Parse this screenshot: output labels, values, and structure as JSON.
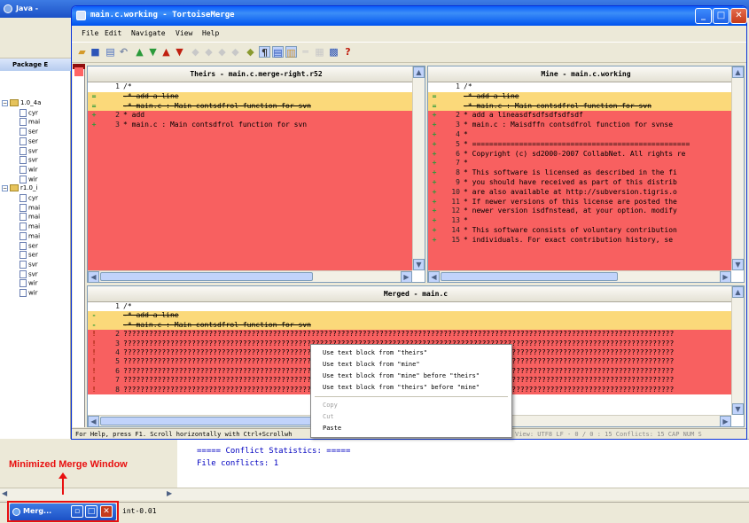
{
  "eclipse": {
    "title": "Java - ",
    "panel_tab": "Package E",
    "tree": [
      {
        "label": "1.0_4a",
        "kind": "folder"
      },
      {
        "label": "cyr",
        "kind": "file"
      },
      {
        "label": "mai",
        "kind": "file"
      },
      {
        "label": "ser",
        "kind": "file"
      },
      {
        "label": "ser",
        "kind": "file"
      },
      {
        "label": "svr",
        "kind": "file"
      },
      {
        "label": "svr",
        "kind": "file"
      },
      {
        "label": "wir",
        "kind": "file"
      },
      {
        "label": "wir",
        "kind": "file"
      },
      {
        "label": "r1.0_i",
        "kind": "folder"
      },
      {
        "label": "cyr",
        "kind": "file"
      },
      {
        "label": "mai",
        "kind": "file"
      },
      {
        "label": "mai",
        "kind": "file"
      },
      {
        "label": "mai",
        "kind": "file"
      },
      {
        "label": "mai",
        "kind": "file"
      },
      {
        "label": "ser",
        "kind": "file"
      },
      {
        "label": "ser",
        "kind": "file"
      },
      {
        "label": "svr",
        "kind": "file"
      },
      {
        "label": "svr",
        "kind": "file"
      },
      {
        "label": "wir",
        "kind": "file"
      },
      {
        "label": "wir",
        "kind": "file"
      }
    ],
    "console_lines": [
      "===== Conflict Statistics: =====",
      "File conflicts: 1"
    ],
    "status_right": "int-0.01"
  },
  "annotation": {
    "text": "Minimized Merge Window"
  },
  "minimized": {
    "title": "Merg..."
  },
  "window": {
    "title": "main.c.working - TortoiseMerge",
    "menu": [
      "File",
      "Edit",
      "Navigate",
      "View",
      "Help"
    ],
    "status": "For Help, press F1. Scroll horizontally with Ctrl+Scrollwh",
    "status_right": "View: UTF8 LF   - 0 / 0 : 15  Conflicts: 15  CAP NUM S"
  },
  "theirs": {
    "header": "Theirs - main.c.merge-right.r52",
    "rows": [
      {
        "gutter": "",
        "num": "1",
        "text": "/*",
        "bg": "white",
        "strike": false
      },
      {
        "gutter": "=",
        "num": "",
        "text": "-* add a line",
        "bg": "orange",
        "strike": true
      },
      {
        "gutter": "=",
        "num": "",
        "text": "-* main.c :  Main contsdfrol function for svn",
        "bg": "orange",
        "strike": true
      },
      {
        "gutter": "+",
        "num": "2",
        "text": " * add",
        "bg": "red",
        "strike": false
      },
      {
        "gutter": "+",
        "num": "3",
        "text": " * main.c :  Main contsdfrol function for svn",
        "bg": "red",
        "strike": false
      }
    ]
  },
  "mine": {
    "header": "Mine - main.c.working",
    "rows": [
      {
        "gutter": "",
        "num": "1",
        "text": "/*",
        "bg": "white",
        "strike": false
      },
      {
        "gutter": "=",
        "num": "",
        "text": "-* add a line",
        "bg": "orange",
        "strike": true
      },
      {
        "gutter": "=",
        "num": "",
        "text": "-* main.c :  Main contsdfrol function for svn",
        "bg": "orange",
        "strike": true
      },
      {
        "gutter": "+",
        "num": "2",
        "text": " * add a lineasdfsdfsdfsdfsdf",
        "bg": "red",
        "strike": false
      },
      {
        "gutter": "+",
        "num": "3",
        "text": " * main.c :  Maisdffn contsdfrol function for svnse",
        "bg": "red",
        "strike": false
      },
      {
        "gutter": "+",
        "num": "4",
        "text": " *",
        "bg": "red",
        "strike": false
      },
      {
        "gutter": "+",
        "num": "5",
        "text": " * ===================================================",
        "bg": "red",
        "strike": false
      },
      {
        "gutter": "+",
        "num": "6",
        "text": " * Copyright (c) sd2000-2007 CollabNet.  All rights re",
        "bg": "red",
        "strike": false
      },
      {
        "gutter": "+",
        "num": "7",
        "text": " *",
        "bg": "red",
        "strike": false
      },
      {
        "gutter": "+",
        "num": "8",
        "text": " * This software is licensed as described in the fi",
        "bg": "red",
        "strike": false
      },
      {
        "gutter": "+",
        "num": "9",
        "text": " * you should have received as part of this distrib",
        "bg": "red",
        "strike": false
      },
      {
        "gutter": "+",
        "num": "10",
        "text": " * are also available at http://subversion.tigris.o",
        "bg": "red",
        "strike": false
      },
      {
        "gutter": "+",
        "num": "11",
        "text": " * If newer versions of this license are posted the",
        "bg": "red",
        "strike": false
      },
      {
        "gutter": "+",
        "num": "12",
        "text": " * newer version isdfnstead, at your option. modify",
        "bg": "red",
        "strike": false
      },
      {
        "gutter": "+",
        "num": "13",
        "text": " *",
        "bg": "red",
        "strike": false
      },
      {
        "gutter": "+",
        "num": "14",
        "text": " * This software consists of voluntary contribution",
        "bg": "red",
        "strike": false
      },
      {
        "gutter": "+",
        "num": "15",
        "text": " * individuals.  For exact contribution history, se",
        "bg": "red",
        "strike": false
      }
    ]
  },
  "merged": {
    "header": "Merged - main.c",
    "rows": [
      {
        "gutter": "",
        "num": "1",
        "text": "/*",
        "bg": "white",
        "strike": false
      },
      {
        "gutter": "-",
        "num": "",
        "text": "-* add a line",
        "bg": "orange",
        "strike": true
      },
      {
        "gutter": "-",
        "num": "",
        "text": "-* main.c :  Main contsdfrol function for svn",
        "bg": "orange",
        "strike": true
      },
      {
        "gutter": "!",
        "num": "2",
        "text": "?????????????????????????????????????????????????????????????????????????????????????????????????????????????????????????????????",
        "bg": "red",
        "strike": false
      },
      {
        "gutter": "!",
        "num": "3",
        "text": "?????????????????????????????????????????????????????????????????????????????????????????????????????????????????????????????????",
        "bg": "red",
        "strike": false
      },
      {
        "gutter": "!",
        "num": "4",
        "text": "?????????????????????????????????????????????????????????????????????????????????????????????????????????????????????????????????",
        "bg": "red",
        "strike": false
      },
      {
        "gutter": "!",
        "num": "5",
        "text": "?????????????????????????????????????????????????????????????????????????????????????????????????????????????????????????????????",
        "bg": "red",
        "strike": false
      },
      {
        "gutter": "!",
        "num": "6",
        "text": "?????????????????????????????????????????????????????????????????????????????????????????????????????????????????????????????????",
        "bg": "red",
        "strike": false
      },
      {
        "gutter": "!",
        "num": "7",
        "text": "?????????????????????????????????????????????????????????????????????????????????????????????????????????????????????????????????",
        "bg": "red",
        "strike": false
      },
      {
        "gutter": "!",
        "num": "8",
        "text": "?????????????????????????????????????????????????????????????????????????????????????????????????????????????????????????????????",
        "bg": "red",
        "strike": false
      }
    ]
  },
  "context_menu": {
    "items": [
      {
        "label": "Use text block from \"theirs\"",
        "enabled": true
      },
      {
        "label": "Use text block from \"mine\"",
        "enabled": true
      },
      {
        "label": "Use text block from \"mine\" before \"theirs\"",
        "enabled": true
      },
      {
        "label": "Use text block from \"theirs\" before \"mine\"",
        "enabled": true
      },
      {
        "label": "Copy",
        "enabled": false
      },
      {
        "label": "Cut",
        "enabled": false
      },
      {
        "label": "Paste",
        "enabled": true
      }
    ]
  }
}
